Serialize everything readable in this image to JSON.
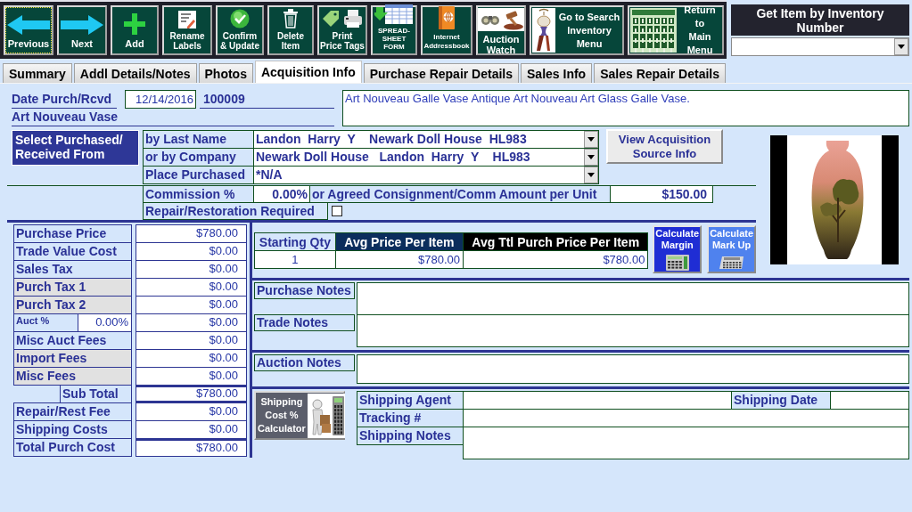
{
  "toolbar": {
    "buttons": [
      {
        "label": "Previous",
        "kind": "previous",
        "focused": true
      },
      {
        "label": "Next",
        "kind": "next",
        "focused": false
      },
      {
        "label": "Add",
        "kind": "add",
        "focused": false
      },
      {
        "label": "Rename\nLabels",
        "kind": "rename",
        "focused": false
      },
      {
        "label": "Confirm\n& Update",
        "kind": "confirm",
        "focused": false
      },
      {
        "label": "Delete\nItem",
        "kind": "delete",
        "focused": false
      },
      {
        "label": "Print\nPrice Tags",
        "kind": "print",
        "focused": false
      },
      {
        "label": "SPREAD-\nSHEET\nFORM",
        "kind": "spreadsheet",
        "focused": false
      },
      {
        "label": "Internet\nAddressbook",
        "kind": "addressbook",
        "focused": false
      },
      {
        "label": "Auction\nWatch",
        "kind": "auction",
        "focused": false
      },
      {
        "label": "Go to Search\nInventory\nMenu",
        "kind": "search",
        "focused": false
      },
      {
        "label": "Return to\nMain\nMenu",
        "kind": "home",
        "focused": false
      }
    ]
  },
  "lookup": {
    "title": "Get Item by Inventory\nNumber"
  },
  "tabs": [
    {
      "label": "Summary",
      "selected": false
    },
    {
      "label": "Addl Details/Notes",
      "selected": false
    },
    {
      "label": "Photos",
      "selected": false
    },
    {
      "label": "Acquisition Info",
      "selected": true
    },
    {
      "label": "Purchase Repair Details",
      "selected": false
    },
    {
      "label": "Sales Info",
      "selected": false
    },
    {
      "label": "Sales Repair Details",
      "selected": false
    }
  ],
  "item": {
    "date_label": "Date Purch/Rcvd",
    "date": "12/14/2016",
    "inventory_number": "100009",
    "name": "Art Nouveau Vase",
    "description": "Art Nouveau Galle Vase Antique Art Nouveau Art Glass Galle Vase."
  },
  "source": {
    "title": "Select Purchased/\nReceived From",
    "fields": [
      {
        "label": "by Last Name",
        "value": "Landon  Harry  Y    Newark Doll House  HL983"
      },
      {
        "label": "or by Company",
        "value": "Newark Doll House   Landon  Harry  Y    HL983"
      },
      {
        "label": "Place Purchased",
        "value": "*N/A"
      }
    ],
    "button": "View Acquisition\nSource Info"
  },
  "commission": {
    "label": "Commission %",
    "value": "0.00%",
    "alt_label": "or Agreed Consignment/Comm Amount per Unit",
    "alt_value": "$150.00"
  },
  "repair": {
    "label": "Repair/Restoration Required",
    "checked": false
  },
  "costs": [
    {
      "label": "Purchase Price",
      "value": "$780.00",
      "kind": "line",
      "highlighted": false
    },
    {
      "label": "Trade Value Cost",
      "value": "$0.00",
      "kind": "line",
      "highlighted": false
    },
    {
      "label": "Sales Tax",
      "value": "$0.00",
      "kind": "line",
      "highlighted": false
    },
    {
      "label": "Purch Tax 1",
      "value": "$0.00",
      "kind": "line",
      "highlighted": true
    },
    {
      "label": "Purch Tax 2",
      "value": "$0.00",
      "kind": "line",
      "highlighted": true
    },
    {
      "label": "Auct %",
      "rate": "0.00%",
      "value": "$0.00",
      "kind": "percent",
      "highlighted": false
    },
    {
      "label": "Misc Auct Fees",
      "value": "$0.00",
      "kind": "line",
      "highlighted": false
    },
    {
      "label": "Import Fees",
      "value": "$0.00",
      "kind": "line",
      "highlighted": true
    },
    {
      "label": "Misc Fees",
      "value": "$0.00",
      "kind": "line",
      "highlighted": true
    },
    {
      "label": "Sub Total",
      "value": "$780.00",
      "kind": "subtotal",
      "highlighted": false
    },
    {
      "label": "Repair/Rest Fee",
      "value": "$0.00",
      "kind": "line",
      "highlighted": false
    },
    {
      "label": "Shipping Costs",
      "value": "$0.00",
      "kind": "line",
      "highlighted": false
    },
    {
      "label": "Total Purch Cost",
      "value": "$780.00",
      "kind": "total",
      "highlighted": false
    }
  ],
  "quantity_table": {
    "columns": [
      "Starting Qty",
      "Avg Price Per Item",
      "Avg Ttl Purch Price Per Item"
    ],
    "rows": [
      [
        "1",
        "$780.00",
        "$780.00"
      ]
    ]
  },
  "calculate_buttons": [
    {
      "label": "Calculate\nMargin",
      "kind": "margin"
    },
    {
      "label": "Calculate\nMark Up",
      "kind": "markup"
    }
  ],
  "note_groups": [
    {
      "fields": [
        {
          "label": "Purchase Notes"
        },
        {
          "label": "Trade Notes"
        }
      ]
    },
    {
      "fields": [
        {
          "label": "Auction Notes"
        }
      ]
    }
  ],
  "shipping": {
    "calculator_button": "Shipping\nCost %\nCalculator",
    "rows": [
      {
        "fields": [
          {
            "label": "Shipping Agent",
            "kind": "text"
          },
          {
            "label": "Shipping Date",
            "kind": "date"
          }
        ]
      },
      {
        "fields": [
          {
            "label": "Tracking #",
            "kind": "text"
          }
        ]
      },
      {
        "fields": [
          {
            "label": "Shipping Notes",
            "kind": "notes"
          }
        ]
      }
    ]
  }
}
